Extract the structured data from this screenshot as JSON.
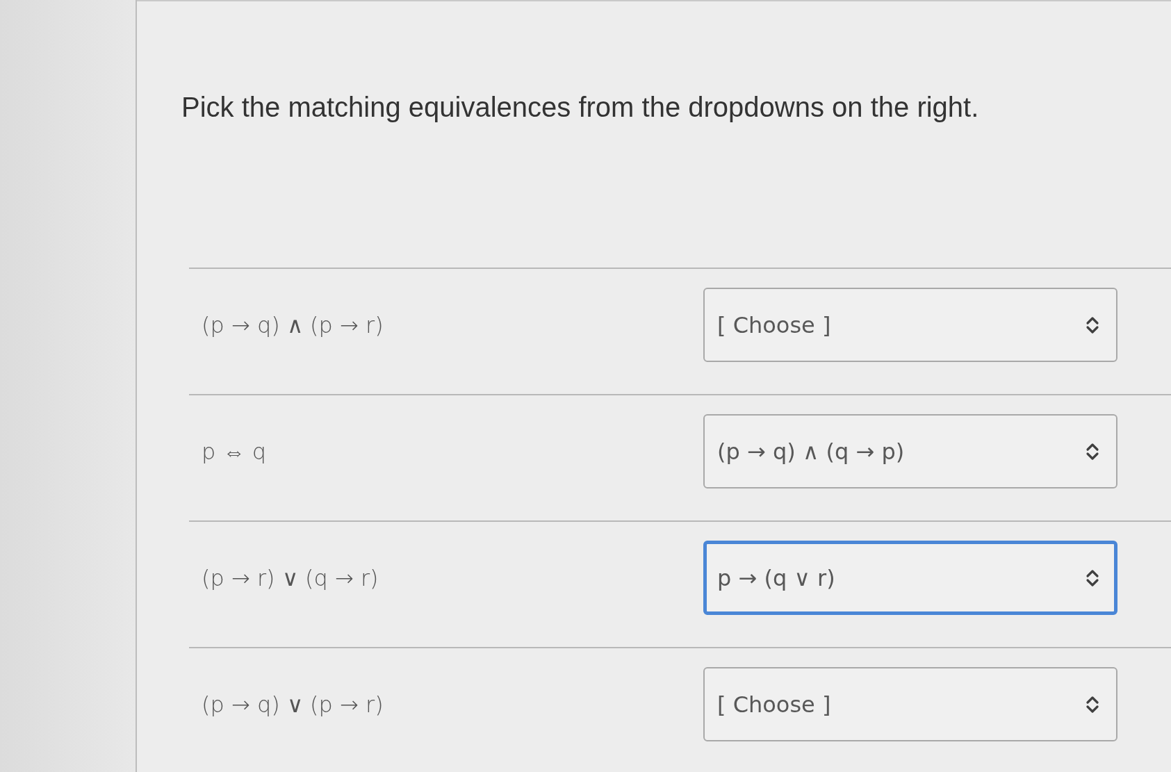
{
  "prompt": "Pick the matching equivalences from the dropdowns on the right.",
  "matches": [
    {
      "statement": "(p → q) ∧ (p → r)",
      "dropdown": {
        "value": "[ Choose ]",
        "focused": false
      }
    },
    {
      "statement": "p ⇔ q",
      "dropdown": {
        "value": "(p → q) ∧ (q → p)",
        "focused": false
      }
    },
    {
      "statement": "(p → r) ∨ (q → r)",
      "dropdown": {
        "value": "p → (q ∨ r)",
        "focused": true
      }
    },
    {
      "statement": "(p → q) ∨ (p → r)",
      "dropdown": {
        "value": "[ Choose ]",
        "focused": false
      }
    }
  ]
}
